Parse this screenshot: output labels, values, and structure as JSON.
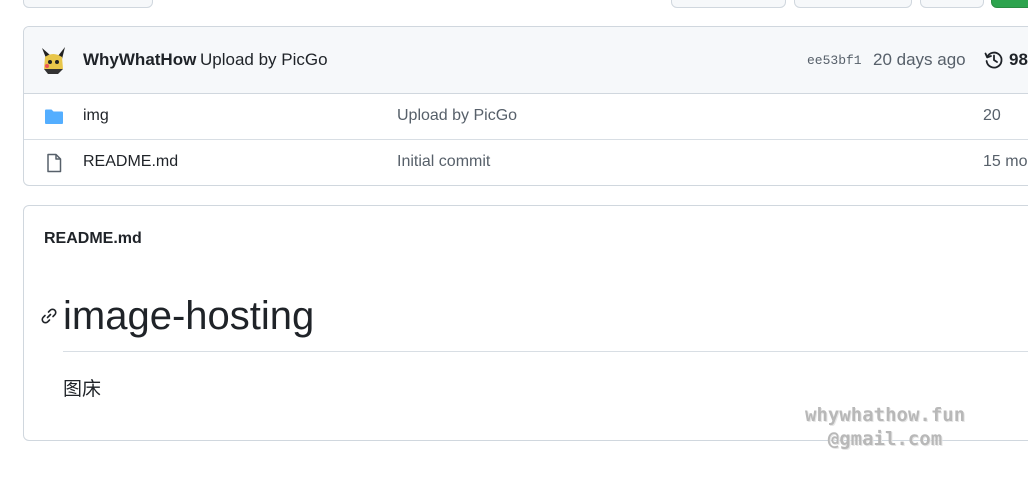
{
  "latest_commit": {
    "author": "WhyWhatHow",
    "message": "Upload by PicGo",
    "sha": "ee53bf1",
    "age": "20 days ago",
    "history_count": "98"
  },
  "files": [
    {
      "type": "folder",
      "icon": "folder-icon",
      "name": "img",
      "commit_message": "Upload by PicGo",
      "age": "20"
    },
    {
      "type": "file",
      "icon": "file-icon",
      "name": "README.md",
      "commit_message": "Initial commit",
      "age": "15 mo"
    }
  ],
  "readme": {
    "label": "README.md",
    "heading": "image-hosting",
    "body": "图床"
  },
  "watermark": {
    "line1": "whywhathow.fun",
    "line2": "@gmail.com"
  },
  "colors": {
    "folder": "#54aeff",
    "primary_button": "#2da44e",
    "muted_text": "#57606a"
  }
}
